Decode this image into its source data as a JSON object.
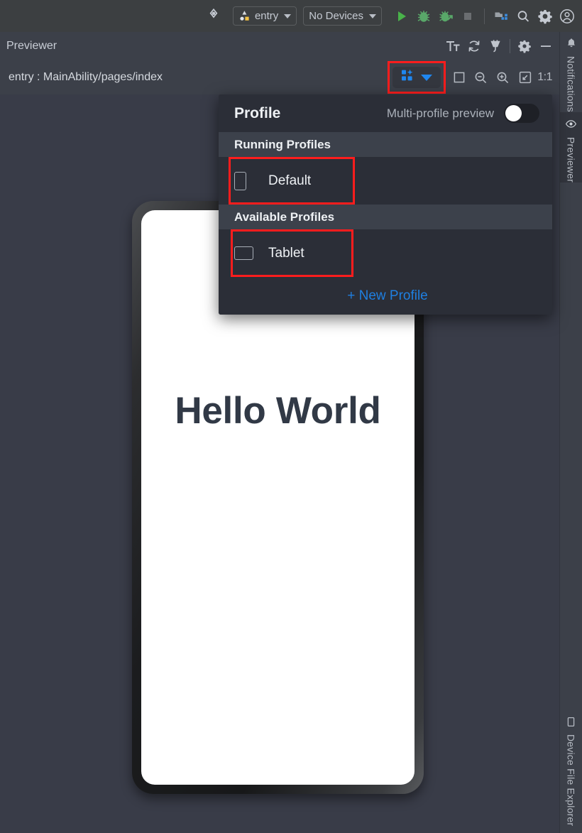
{
  "ide_toolbar": {
    "target_icon": "target-icon",
    "module_selector": {
      "label": "entry",
      "icon": "module-icon",
      "caret": "chevron-down-icon"
    },
    "device_selector": {
      "label": "No Devices",
      "caret": "chevron-down-icon"
    },
    "actions": [
      {
        "name": "run-button",
        "icon": "play-icon",
        "color": "#4caf50"
      },
      {
        "name": "debug-button",
        "icon": "bug-icon",
        "color": "#59a869"
      },
      {
        "name": "attach-debugger-button",
        "icon": "bug-attach-icon",
        "color": "#59a869"
      },
      {
        "name": "stop-button",
        "icon": "stop-square-icon",
        "color": "#6a6d70"
      },
      {
        "name": "device-manager-button",
        "icon": "device-manager-icon",
        "color": "#9aa0a6"
      },
      {
        "name": "search-everywhere-button",
        "icon": "search-icon",
        "color": "#c5cad2"
      },
      {
        "name": "settings-button",
        "icon": "gear-icon",
        "color": "#c5cad2"
      },
      {
        "name": "account-button",
        "icon": "account-circle-icon",
        "color": "#c5cad2"
      }
    ]
  },
  "previewer": {
    "title": "Previewer",
    "header_actions": [
      {
        "name": "font-size-button",
        "icon": "text-size-icon",
        "label": "Tt"
      },
      {
        "name": "refresh-button",
        "icon": "refresh-icon"
      },
      {
        "name": "inspector-button",
        "icon": "plug-icon"
      },
      {
        "name": "previewer-settings-button",
        "icon": "gear-icon"
      },
      {
        "name": "minimize-button",
        "icon": "minimize-icon"
      }
    ],
    "file_path": "entry : MainAbility/pages/index",
    "profile_button": {
      "icon": "multi-profile-grid-icon",
      "caret": "chevron-down-icon",
      "highlighted": true
    },
    "zoom_actions": [
      {
        "name": "fit-frame-button",
        "icon": "frame-icon"
      },
      {
        "name": "zoom-out-button",
        "icon": "zoom-out-icon"
      },
      {
        "name": "zoom-in-button",
        "icon": "zoom-in-icon"
      },
      {
        "name": "zoom-to-fit-button",
        "icon": "expand-icon"
      }
    ],
    "zoom_ratio": "1:1",
    "preview_text": "Hello World"
  },
  "profile_panel": {
    "title": "Profile",
    "multi_profile_label": "Multi-profile preview",
    "multi_profile_enabled": false,
    "sections": [
      {
        "header": "Running Profiles",
        "items": [
          {
            "label": "Default",
            "icon": "device-portrait-icon",
            "highlighted": true
          }
        ]
      },
      {
        "header": "Available Profiles",
        "items": [
          {
            "label": "Tablet",
            "icon": "device-landscape-icon",
            "highlighted": true
          }
        ]
      }
    ],
    "new_profile_label": "+ New Profile"
  },
  "right_sidebar": {
    "top_items": [
      {
        "label": "Notifications",
        "icon": "bell-icon",
        "active": false
      },
      {
        "label": "Previewer",
        "icon": "eye-icon",
        "active": true
      }
    ],
    "bottom_items": [
      {
        "label": "Device File Explorer",
        "icon": "device-file-icon",
        "active": false
      }
    ]
  },
  "colors": {
    "highlight_red": "#fe1d1d",
    "accent_blue": "#1f87f0",
    "link_blue": "#1f7fe0",
    "toolbar_bg": "#3c3f41",
    "panel_bg": "#2b2e37",
    "section_bg": "#3c414b",
    "canvas_bg": "#393c48",
    "hello_text": "#313946"
  }
}
